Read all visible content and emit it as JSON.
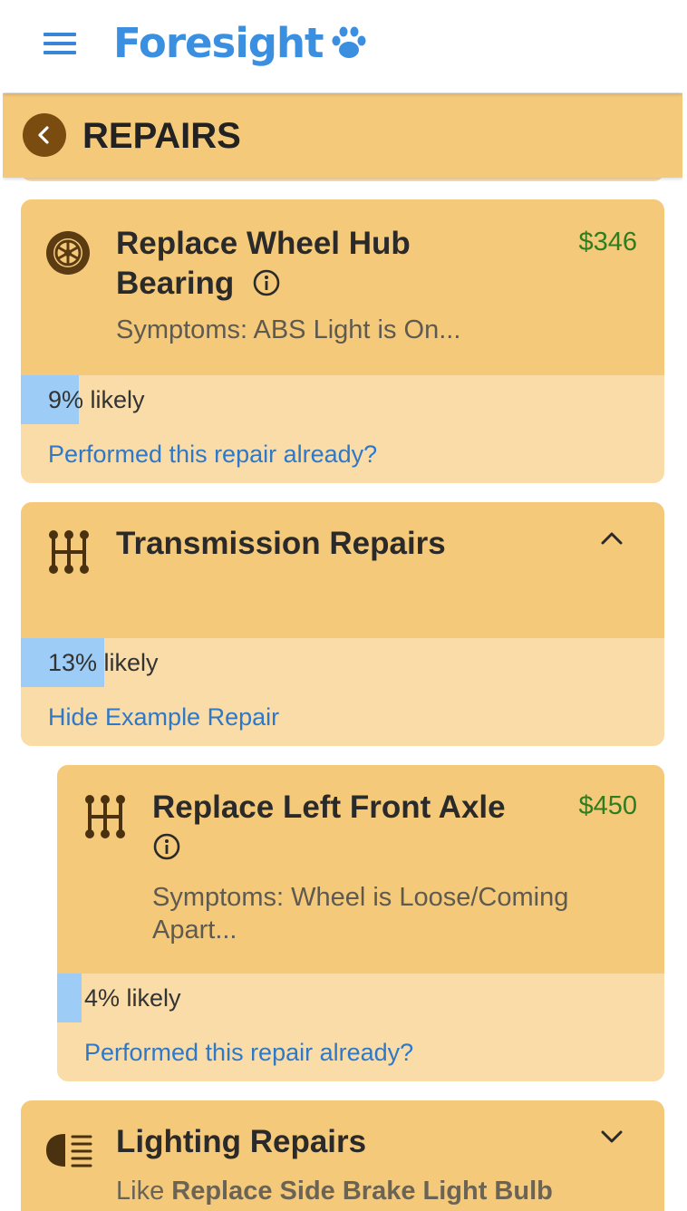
{
  "header": {
    "logo_text": "Foresight",
    "brand_color": "#3a8fe0"
  },
  "subheader": {
    "title": "REPAIRS",
    "background": "#f5c97a"
  },
  "cards": [
    {
      "icon": "wheel-icon",
      "title_line1": "Replace Wheel Hub",
      "title_line2": "Bearing",
      "price": "$346",
      "symptoms": "Symptoms: ABS Light is On...",
      "likelihood_percent": 9,
      "likelihood_text": "9% likely",
      "link": "Performed this repair already?"
    },
    {
      "icon": "gear-shift-icon",
      "title": "Transmission Repairs",
      "expanded": true,
      "likelihood_percent": 13,
      "likelihood_text": "13% likely",
      "link": "Hide Example Repair",
      "example_repair": {
        "icon": "gear-shift-icon",
        "title": "Replace Left Front Axle",
        "price": "$450",
        "symptoms_line1": "Symptoms: Wheel is Loose/Coming",
        "symptoms_line2": "Apart...",
        "likelihood_percent": 4,
        "likelihood_text": "4% likely",
        "link": "Performed this repair already?"
      }
    },
    {
      "icon": "headlight-icon",
      "title": "Lighting Repairs",
      "expanded": false,
      "like_prefix": "Like ",
      "like_repair": "Replace Side Brake Light Bulb"
    }
  ]
}
